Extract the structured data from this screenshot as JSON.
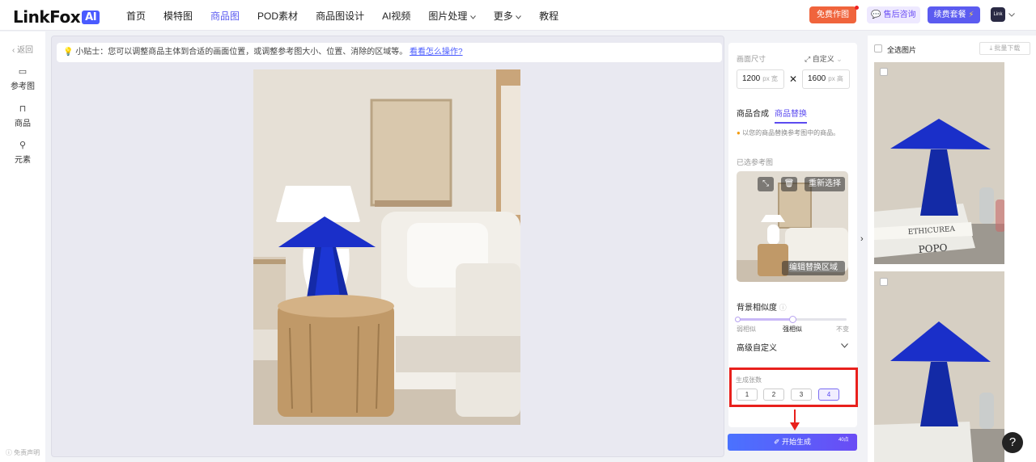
{
  "brand": {
    "name": "LinkFox",
    "ai_badge": "AI"
  },
  "nav": {
    "items": [
      "首页",
      "模特图",
      "商品图",
      "POD素材",
      "商品图设计",
      "AI视频",
      "图片处理",
      "更多",
      "教程"
    ],
    "active_index": 2
  },
  "topbar_buttons": {
    "free_make": "免费作图",
    "after_sales": "售后咨询",
    "renew": "续费套餐"
  },
  "avatar_text": "Link Fox",
  "left_nav": {
    "back": "返回",
    "reference": "参考图",
    "product": "商品",
    "element": "元素",
    "disclaimer": "免责声明"
  },
  "tip": {
    "label": "小贴士：",
    "text": "您可以调整商品主体到合适的画面位置，或调整参考图大小、位置、消除的区域等。",
    "link": "看看怎么操作?"
  },
  "canvas_settings": {
    "size_label": "画面尺寸",
    "size_mode": "自定义",
    "width": "1200",
    "height": "1600",
    "width_unit": "px 宽",
    "height_unit": "px 高",
    "sep": "✕"
  },
  "tabs": {
    "synthesis": "商品合成",
    "replace": "商品替换",
    "active": "replace"
  },
  "notice": "以您的商品替换参考图中的商品。",
  "selected_ref": {
    "label": "已选参考图",
    "reselect": "重新选择",
    "edit_region": "编辑替换区域"
  },
  "similarity": {
    "label": "背景相似度",
    "left": "弱相似",
    "center": "强相似",
    "right": "不变",
    "level": 0.5
  },
  "advanced": {
    "label": "高级自定义"
  },
  "gen_count": {
    "label": "生成张数",
    "options": [
      "1",
      "2",
      "3",
      "4"
    ],
    "selected": "4"
  },
  "start": {
    "label": "开始生成",
    "cost": "40点"
  },
  "gallery": {
    "select_all": "全选图片",
    "batch_download": "批量下载",
    "book_text_1": "ETHICUREA",
    "book_text_2": "POPO"
  },
  "help": "?",
  "colors": {
    "accent": "#5b5bf0",
    "lamp_blue": "#1a2fc9",
    "highlight_red": "#e8201c",
    "free_btn": "#f0643c",
    "renew_btn": "#5b5bf0"
  }
}
